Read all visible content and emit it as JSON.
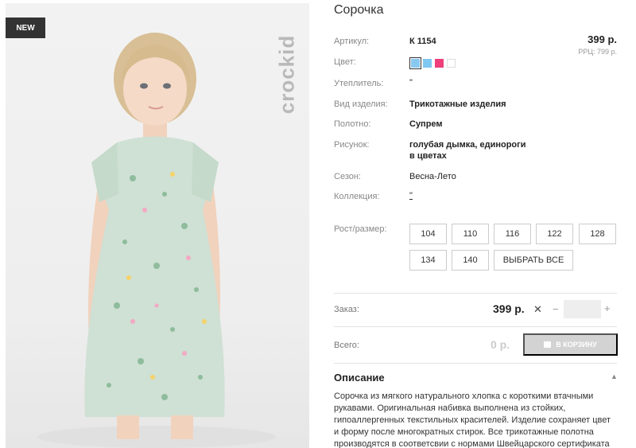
{
  "photo": {
    "badge": "NEW",
    "brand": "crockid"
  },
  "product": {
    "title": "Сорочка",
    "price": "399 р.",
    "rrp": "РРЦ: 799 р.",
    "fields": [
      {
        "label": "Артикул:",
        "value": "К 1154"
      },
      {
        "label": "Цвет:",
        "value": ""
      },
      {
        "label": "Утеплитель:",
        "value": "\""
      },
      {
        "label": "Вид изделия:",
        "value": "Трикотажные изделия"
      },
      {
        "label": "Полотно:",
        "value": "Супрем"
      },
      {
        "label": "Рисунок:",
        "value": "голубая дымка, единороги",
        "value2": "в цветах"
      },
      {
        "label": "Сезон:",
        "value": "Весна-Лето"
      },
      {
        "label": "Коллекция:",
        "value": "\""
      }
    ],
    "colors": [
      "#89c9ef",
      "#7ec8f2",
      "#ee3f7a",
      "#ffffff"
    ],
    "size_label": "Рост/размер:",
    "sizes": [
      "104",
      "110",
      "116",
      "122",
      "128",
      "134",
      "140"
    ],
    "select_all": "ВЫБРАТЬ ВСЕ"
  },
  "order": {
    "label": "Заказ:",
    "price": "399 р.",
    "remove_icon": "close-icon",
    "minus": "−",
    "plus": "+",
    "qty": ""
  },
  "total": {
    "label": "Всего:",
    "value": "0 р.",
    "cart_button": "В КОРЗИНУ"
  },
  "description": {
    "heading": "Описание",
    "text": "Сорочка из мягкого натурального хлопка с короткими втачными рукавами. Оригинальная набивка выполнена из стойких, гипоаллергенных текстильных красителей. Изделие сохраняет цвет и форму после многократных стирок. Все трикотажные полотна производятся в соответсвии с нормами Швейцарского сертификата"
  }
}
